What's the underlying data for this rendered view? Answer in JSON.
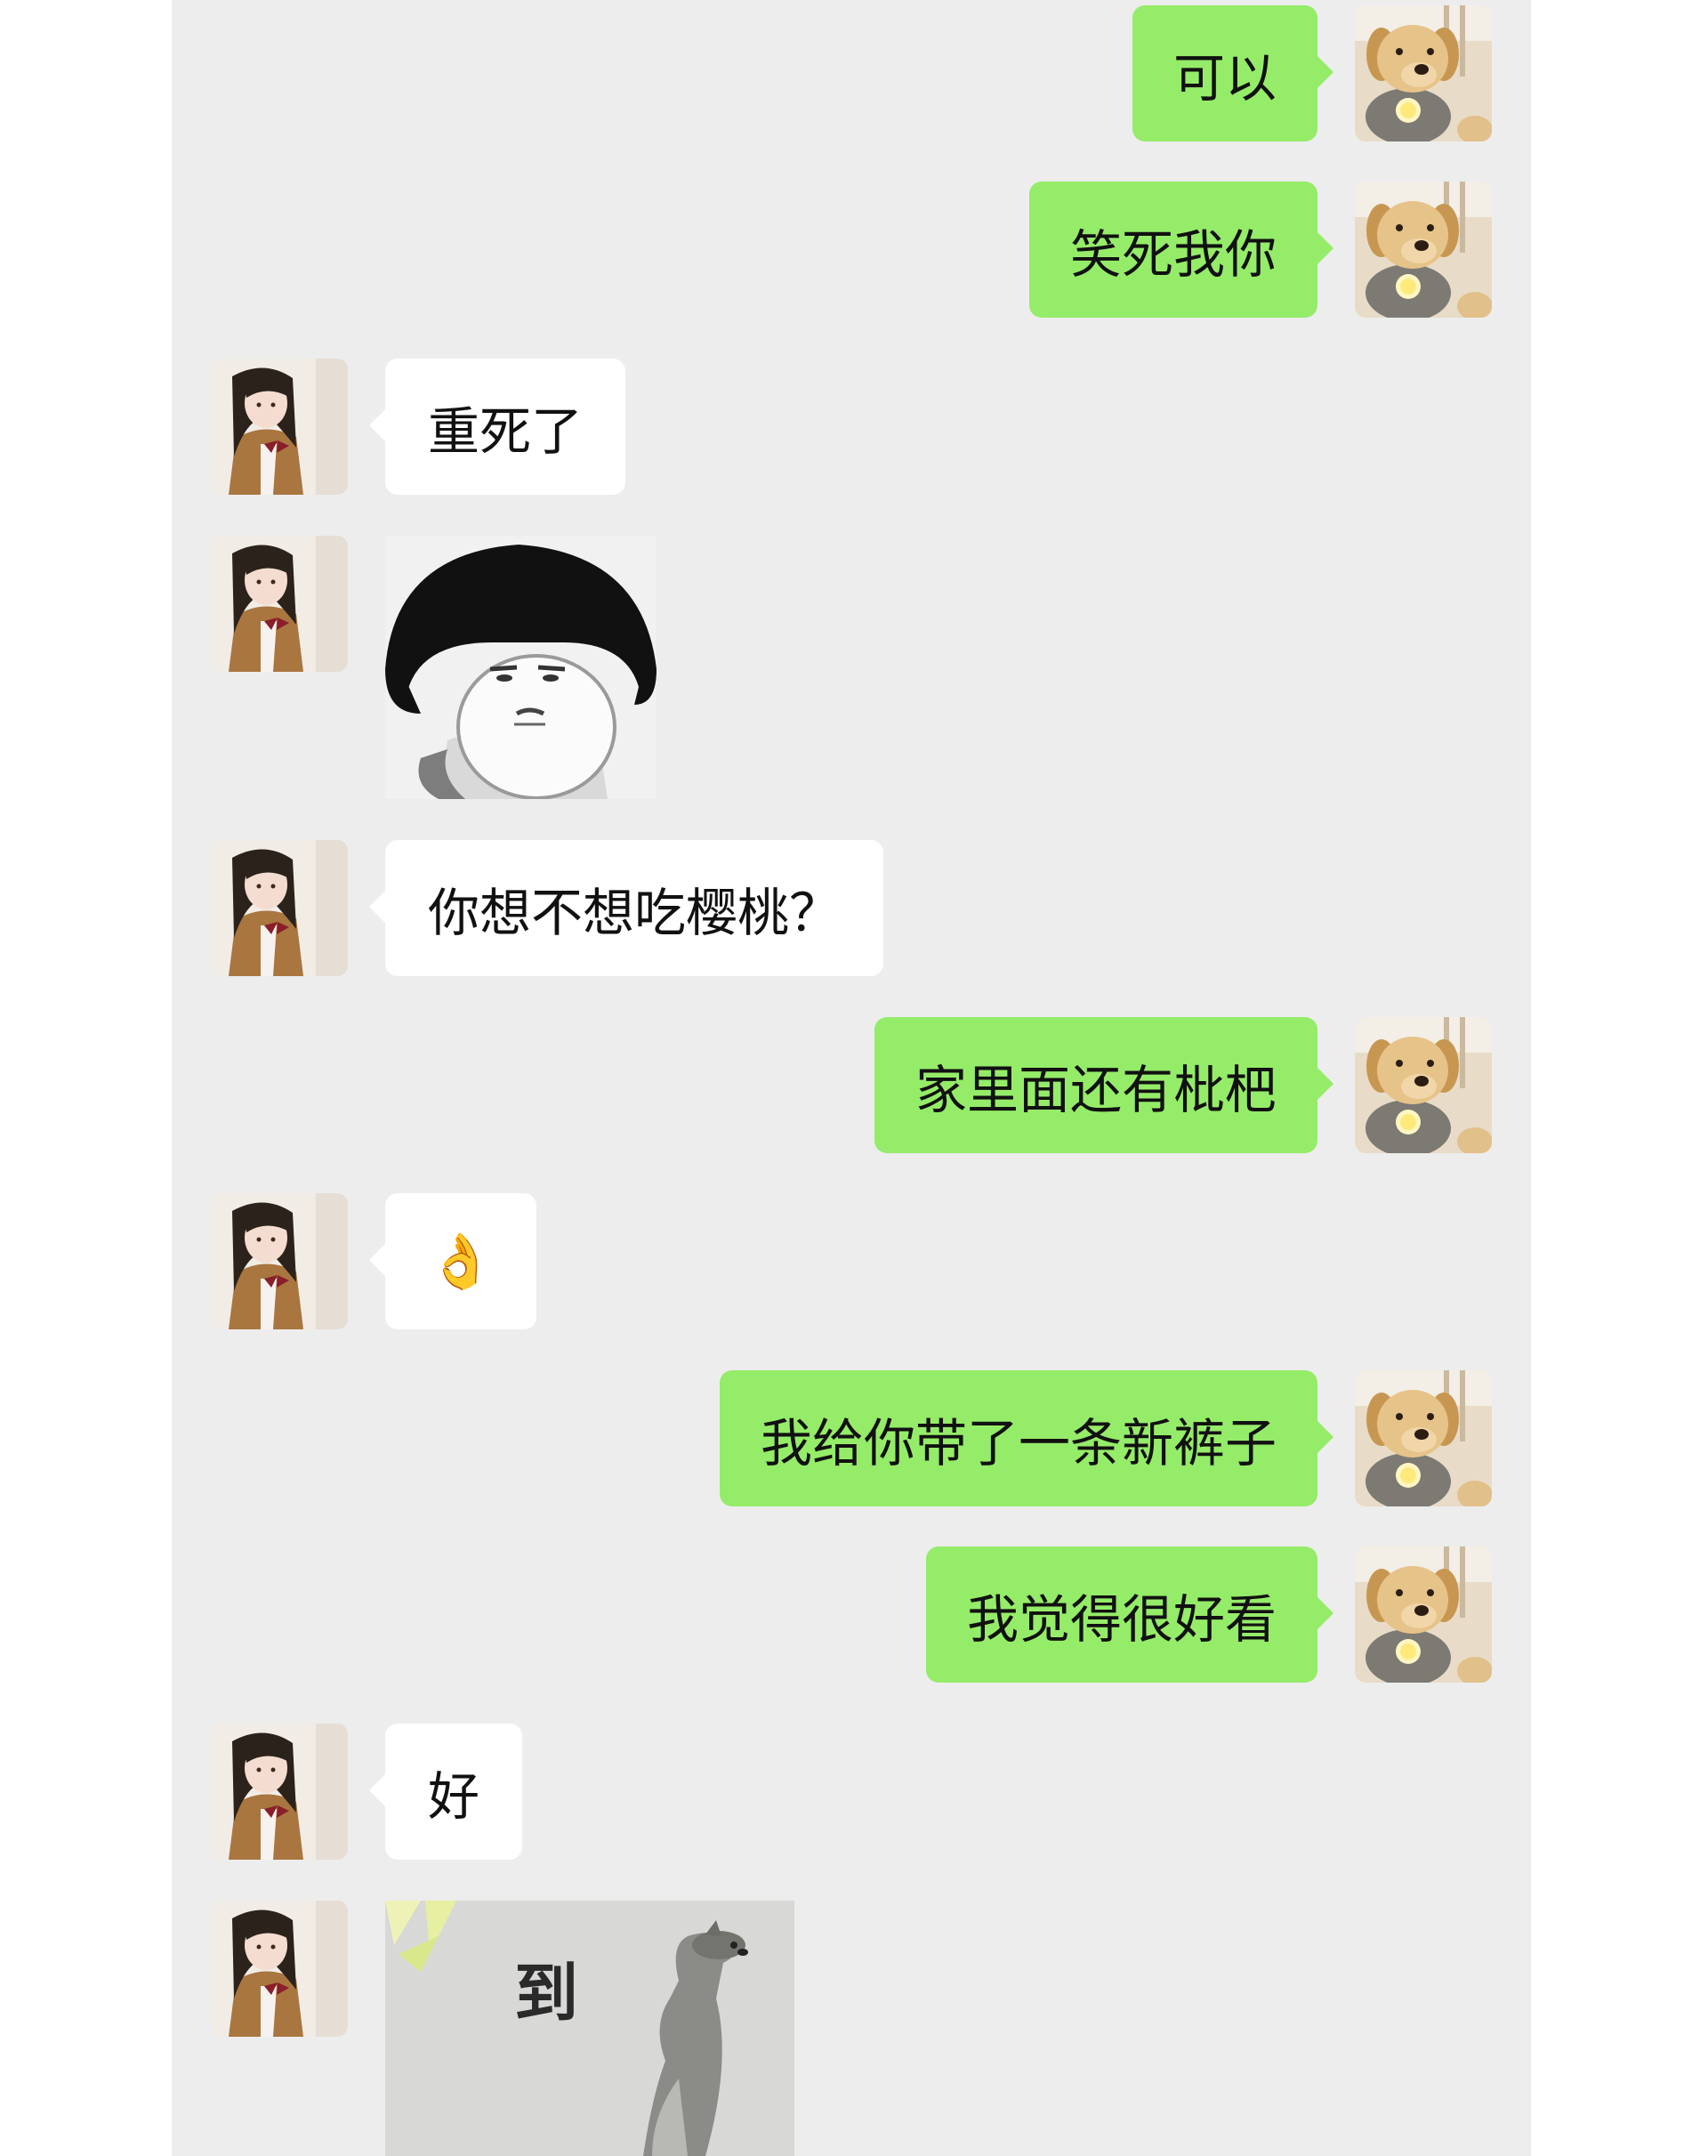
{
  "messages": [
    {
      "sender": "other-user",
      "type": "text",
      "text": "可以"
    },
    {
      "sender": "other-user",
      "type": "text",
      "text": "笑死我你"
    },
    {
      "sender": "girl",
      "type": "text",
      "text": "重死了"
    },
    {
      "sender": "girl",
      "type": "sticker",
      "sticker": "mushroom-head-boy-sticker"
    },
    {
      "sender": "girl",
      "type": "text",
      "text": "你想不想吃樱桃？"
    },
    {
      "sender": "other-user",
      "type": "text",
      "text": "家里面还有枇杷"
    },
    {
      "sender": "girl",
      "type": "emoji",
      "text": "👌"
    },
    {
      "sender": "other-user",
      "type": "text",
      "text": "我给你带了一条新裤子"
    },
    {
      "sender": "other-user",
      "type": "text",
      "text": "我觉得很好看"
    },
    {
      "sender": "girl",
      "type": "text",
      "text": "好"
    },
    {
      "sender": "girl",
      "type": "sticker",
      "sticker": "standing-dog-sticker",
      "caption": "到"
    }
  ],
  "colors": {
    "chat_background": "#ededed",
    "outgoing_bubble": "#95ec69",
    "incoming_bubble": "#ffffff"
  },
  "icons": {
    "self_avatar": "golden-retriever-avatar-icon",
    "girl_avatar": "girl-avatar-icon",
    "ok_emoji": "ok-hand-emoji"
  }
}
